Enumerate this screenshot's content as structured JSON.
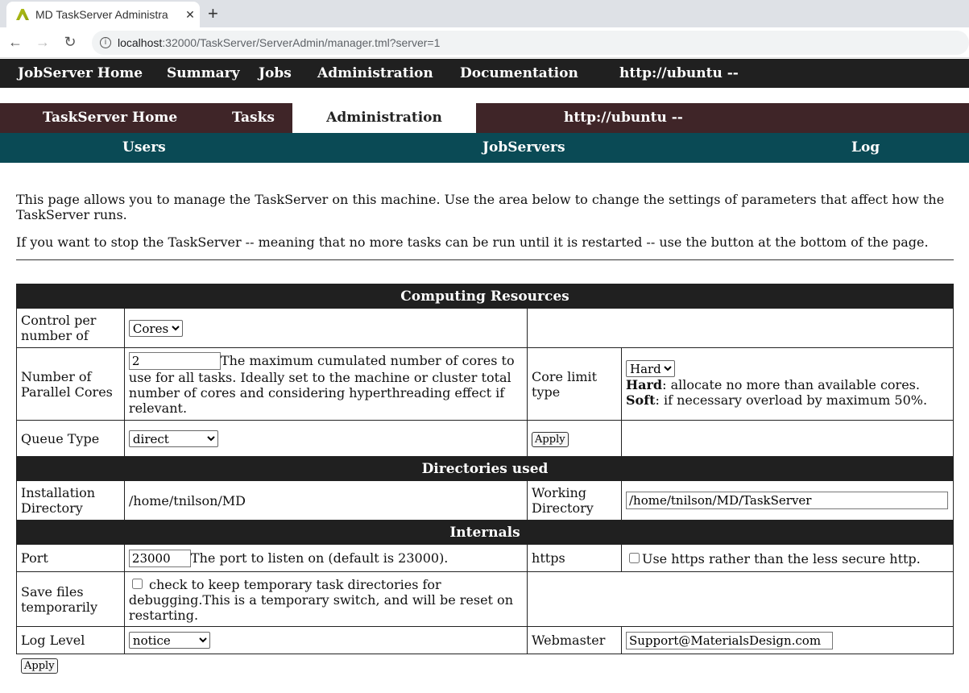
{
  "browser": {
    "tab_title": "MD TaskServer Administra",
    "url_host": "localhost",
    "url_path": ":32000/TaskServer/ServerAdmin/manager.tml?server=1"
  },
  "nav1": [
    "JobServer Home",
    "Summary",
    "Jobs",
    "Administration",
    "Documentation",
    "http://ubuntu --"
  ],
  "nav2": [
    "TaskServer Home",
    "Tasks",
    "Administration",
    "http://ubuntu --"
  ],
  "nav3": [
    "Users",
    "JobServers",
    "Log"
  ],
  "intro": [
    "This page allows you to manage the TaskServer on this machine. Use the area below to change the settings of parameters that affect how the TaskServer runs.",
    "If you want to stop the TaskServer -- meaning that no more tasks can be run until it is restarted -- use the button at the bottom of the page."
  ],
  "sections": {
    "computing": "Computing Resources",
    "dirs": "Directories used",
    "internals": "Internals"
  },
  "rows": {
    "control_label": "Control per number of",
    "control_value": "Cores",
    "cores_label": "Number of Parallel Cores",
    "cores_value": "2",
    "cores_desc": "The maximum cumulated number of cores to use for all tasks. Ideally set to the machine or cluster total number of cores and considering hyperthreading effect if relevant.",
    "limit_label": "Core limit type",
    "limit_value": "Hard",
    "hard_term": "Hard",
    "hard_desc": ": allocate no more than available cores.",
    "soft_term": "Soft",
    "soft_desc": ": if necessary overload by maximum 50%.",
    "queue_label": "Queue Type",
    "queue_value": "direct",
    "apply": "Apply",
    "install_label": "Installation Directory",
    "install_value": "/home/tnilson/MD",
    "work_label": "Working Directory",
    "work_value": "/home/tnilson/MD/TaskServer",
    "port_label": "Port",
    "port_value": "23000",
    "port_desc": "The port to listen on (default is 23000).",
    "https_label": "https",
    "https_desc": "Use https rather than the less secure http.",
    "https_checked": false,
    "save_label": "Save files temporarily",
    "save_desc": "check to keep temporary task directories for debugging.This is a temporary switch, and will be reset on restarting.",
    "save_checked": false,
    "log_label": "Log Level",
    "log_value": "notice",
    "webmaster_label": "Webmaster",
    "webmaster_value": "Support@MaterialsDesign.com"
  },
  "apply_bottom": "Apply"
}
